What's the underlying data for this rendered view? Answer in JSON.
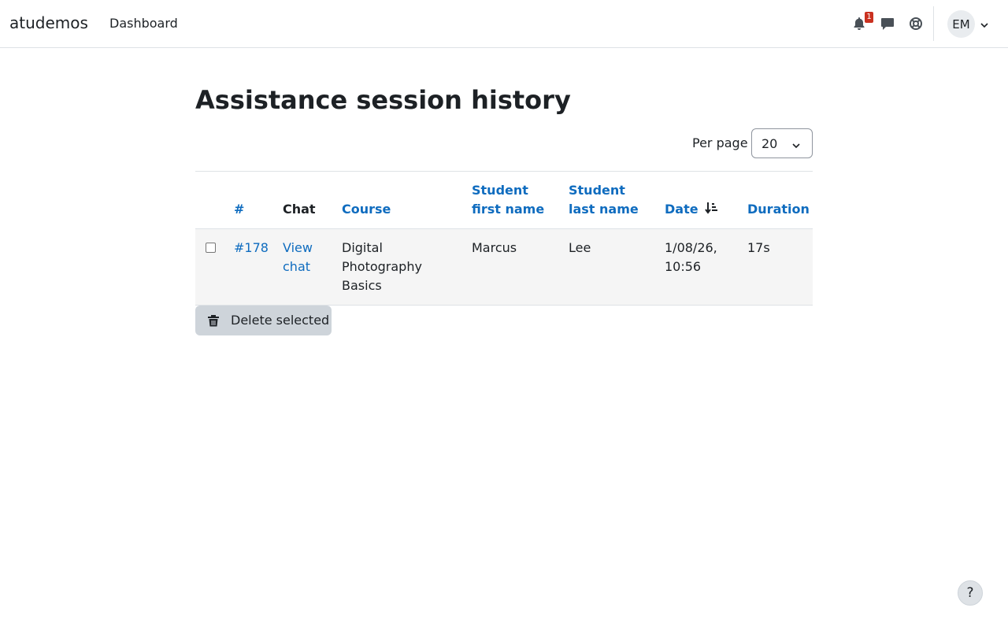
{
  "navbar": {
    "brand": "atudemos",
    "links": [
      {
        "label": "Dashboard"
      }
    ],
    "notifications": {
      "icon": "bell-icon",
      "badge": "1",
      "badge_color": "#ca3120"
    },
    "messages": {
      "icon": "chat-bubble-icon"
    },
    "help": {
      "icon": "lifebuoy-icon"
    },
    "user": {
      "initials": "EM",
      "icon": "chevron-down-icon"
    }
  },
  "page": {
    "title": "Assistance session history",
    "per_page": {
      "label": "Per page",
      "value": "20"
    }
  },
  "table": {
    "columns": [
      {
        "label": "#",
        "sortable": true
      },
      {
        "label": "Chat",
        "sortable": false
      },
      {
        "label": "Course",
        "sortable": true
      },
      {
        "label": "Student first name",
        "sortable": true
      },
      {
        "label": "Student last name",
        "sortable": true
      },
      {
        "label": "Date",
        "sortable": true,
        "sort": "descending"
      },
      {
        "label": "Duration",
        "sortable": true
      }
    ],
    "rows": [
      {
        "selected": false,
        "id": "#178",
        "chat": "View chat",
        "course": "Digital Photography Basics",
        "first_name": "Marcus",
        "last_name": "Lee",
        "date": "1/08/26, 10:56",
        "duration": "17s"
      }
    ]
  },
  "actions": {
    "delete_selected": "Delete selected",
    "icon": "trash-icon"
  },
  "help_fab": {
    "label": "?"
  },
  "colors": {
    "link": "#0f6cbf",
    "row_bg": "#f5f5f5",
    "button_bg": "#ced4da"
  }
}
